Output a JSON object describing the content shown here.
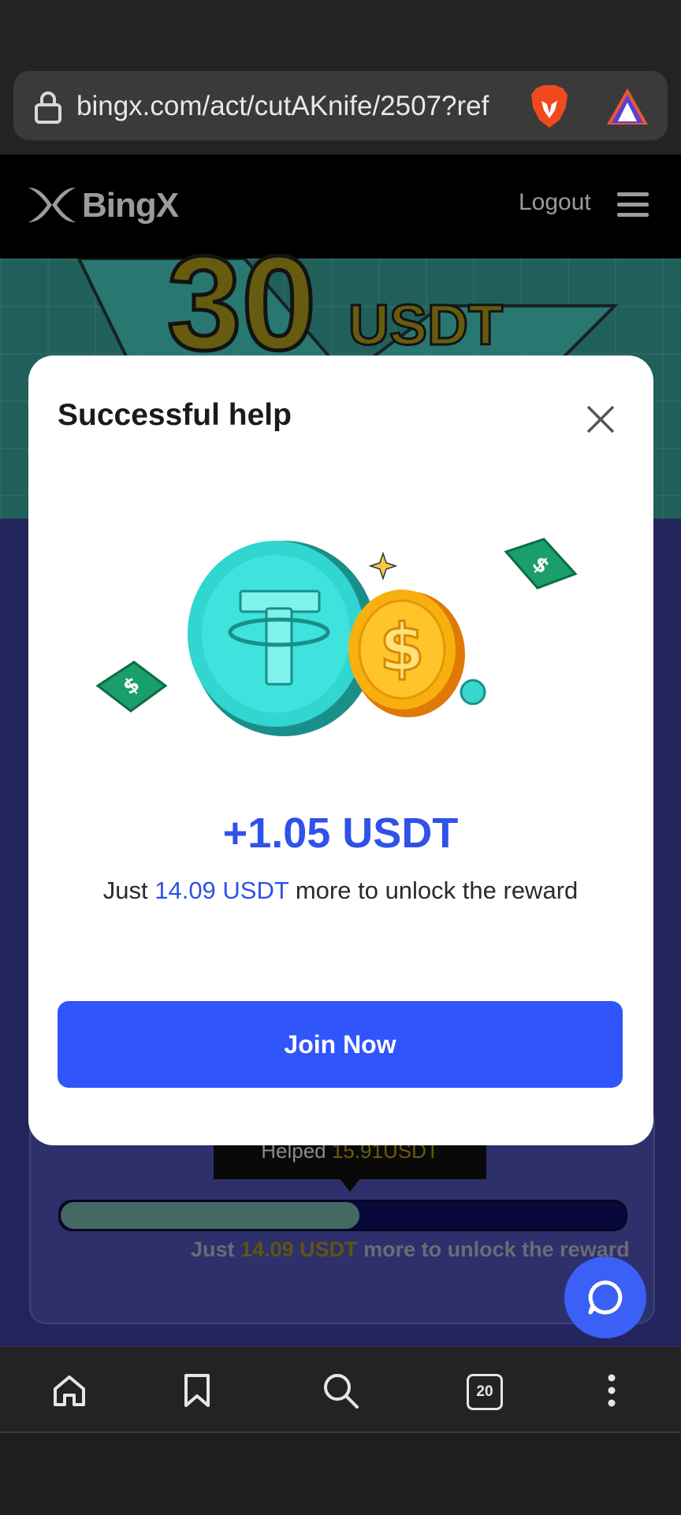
{
  "browser": {
    "url": "bingx.com/act/cutAKnife/2507?ref",
    "tab_count": "20"
  },
  "site": {
    "brand": "BingX",
    "logout_label": "Logout"
  },
  "hero": {
    "amount": "30",
    "unit": "USDT"
  },
  "progress_card": {
    "helped_label": "Helped",
    "helped_value": "15.91USDT",
    "progress_fraction": 0.53,
    "note_prefix": "Just",
    "note_amount": "14.09 USDT",
    "note_suffix": "more to unlock the reward"
  },
  "modal": {
    "title": "Successful help",
    "amount": "+1.05 USDT",
    "note_prefix": "Just",
    "note_amount": "14.09 USDT",
    "note_suffix": "more to unlock the reward",
    "join_label": "Join Now"
  },
  "colors": {
    "accent": "#2f55fb",
    "amount_blue": "#2f52e8",
    "gold": "#8a7a15"
  }
}
